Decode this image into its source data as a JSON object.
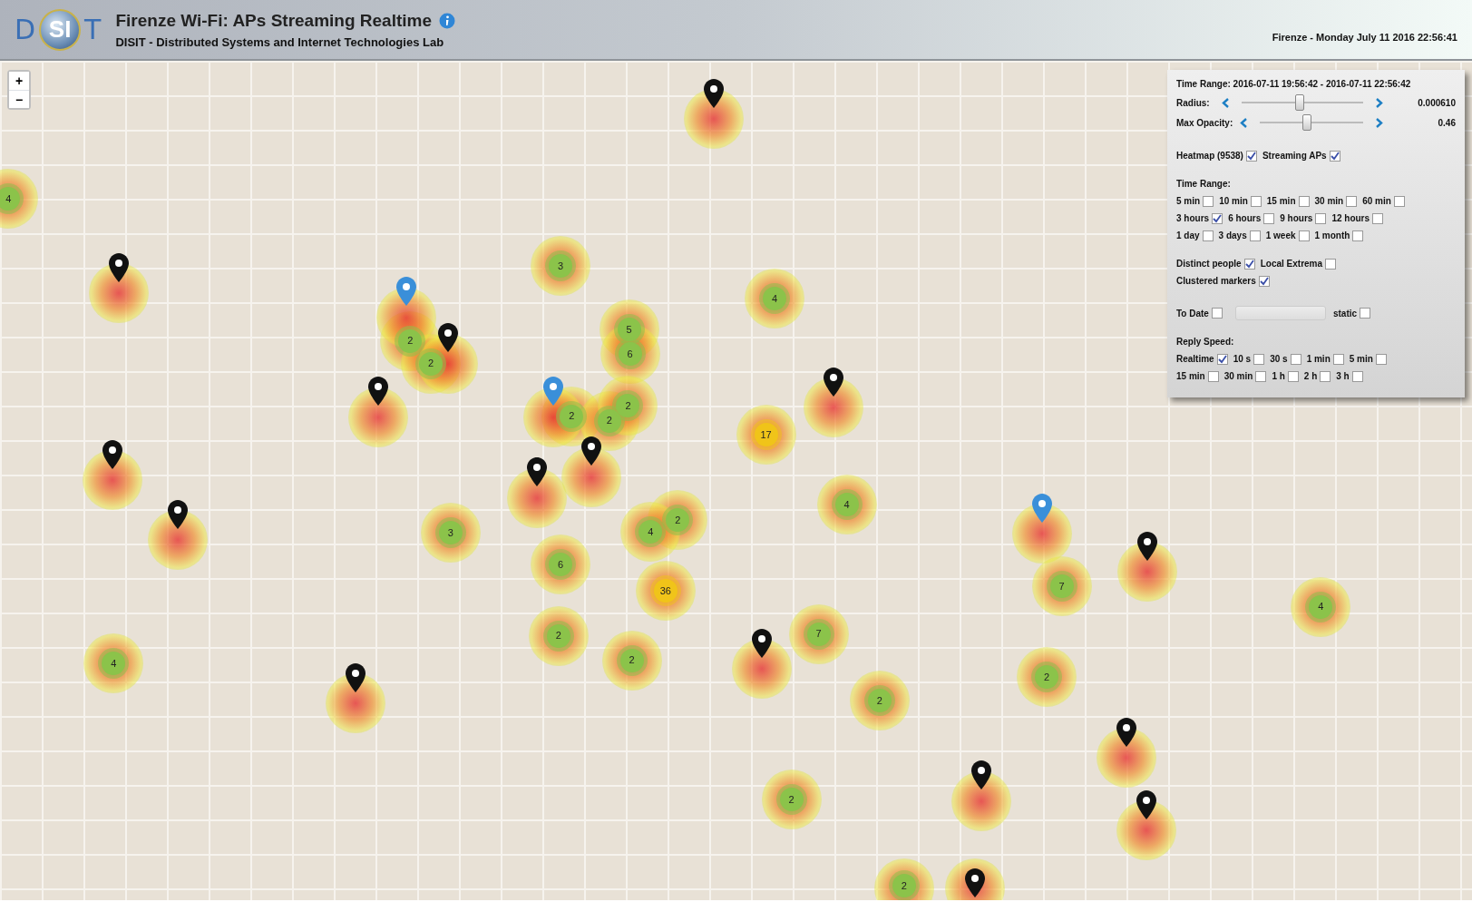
{
  "header": {
    "logo_letters": [
      "D",
      "SI",
      "T"
    ],
    "title": "Firenze Wi-Fi: APs Streaming Realtime",
    "subtitle": "DISIT - Distributed Systems and Internet Technologies Lab",
    "clock": "Firenze - Monday July 11 2016 22:56:41"
  },
  "map": {
    "zoom_in": "+",
    "zoom_out": "−",
    "clusters": [
      {
        "count": "4",
        "color": "#8bc34a"
      },
      {
        "count": "3",
        "color": "#8bc34a"
      },
      {
        "count": "2",
        "color": "#8bc34a"
      },
      {
        "count": "2",
        "color": "#8bc34a"
      },
      {
        "count": "5",
        "color": "#8bc34a"
      },
      {
        "count": "6",
        "color": "#8bc34a"
      },
      {
        "count": "2",
        "color": "#8bc34a"
      },
      {
        "count": "2",
        "color": "#8bc34a"
      },
      {
        "count": "2",
        "color": "#8bc34a"
      },
      {
        "count": "4",
        "color": "#8bc34a"
      },
      {
        "count": "17",
        "color": "#f0c419"
      },
      {
        "count": "4",
        "color": "#8bc34a"
      },
      {
        "count": "2",
        "color": "#8bc34a"
      },
      {
        "count": "4",
        "color": "#8bc34a"
      },
      {
        "count": "3",
        "color": "#8bc34a"
      },
      {
        "count": "6",
        "color": "#8bc34a"
      },
      {
        "count": "36",
        "color": "#f0c419"
      },
      {
        "count": "2",
        "color": "#8bc34a"
      },
      {
        "count": "2",
        "color": "#8bc34a"
      },
      {
        "count": "7",
        "color": "#8bc34a"
      },
      {
        "count": "2",
        "color": "#8bc34a"
      },
      {
        "count": "7",
        "color": "#8bc34a"
      },
      {
        "count": "2",
        "color": "#8bc34a"
      },
      {
        "count": "4",
        "color": "#8bc34a"
      },
      {
        "count": "4",
        "color": "#8bc34a"
      },
      {
        "count": "2",
        "color": "#8bc34a"
      },
      {
        "count": "2",
        "color": "#8bc34a"
      }
    ],
    "pins": [
      {
        "color": "#111111"
      },
      {
        "color": "#111111"
      },
      {
        "color": "#111111"
      },
      {
        "color": "#111111"
      },
      {
        "color": "#111111"
      },
      {
        "color": "#111111"
      },
      {
        "color": "#111111"
      },
      {
        "color": "#111111"
      },
      {
        "color": "#111111"
      },
      {
        "color": "#111111"
      },
      {
        "color": "#111111"
      },
      {
        "color": "#111111"
      },
      {
        "color": "#111111"
      },
      {
        "color": "#111111"
      },
      {
        "color": "#111111"
      },
      {
        "color": "#111111"
      },
      {
        "color": "#3a8fd9"
      },
      {
        "color": "#3a8fd9"
      },
      {
        "color": "#3a8fd9"
      }
    ]
  },
  "panel": {
    "time_range_text": "Time Range: 2016-07-11 19:56:42 - 2016-07-11 22:56:42",
    "sliders": [
      {
        "label": "Radius:",
        "value": "0.000610",
        "level": 0.48
      },
      {
        "label": "Max Opacity:",
        "value": "0.46",
        "level": 0.46
      }
    ],
    "layers": [
      {
        "label": "Heatmap (9538)",
        "checked": true
      },
      {
        "label": "Streaming APs",
        "checked": true
      }
    ],
    "time_range_heading": "Time Range:",
    "time_ranges": [
      [
        {
          "label": "5 min",
          "checked": false
        },
        {
          "label": "10 min",
          "checked": false
        },
        {
          "label": "15 min",
          "checked": false
        },
        {
          "label": "30 min",
          "checked": false
        },
        {
          "label": "60 min",
          "checked": false
        }
      ],
      [
        {
          "label": "3 hours",
          "checked": true
        },
        {
          "label": "6 hours",
          "checked": false
        },
        {
          "label": "9 hours",
          "checked": false
        },
        {
          "label": "12 hours",
          "checked": false
        }
      ],
      [
        {
          "label": "1 day",
          "checked": false
        },
        {
          "label": "3 days",
          "checked": false
        },
        {
          "label": "1 week",
          "checked": false
        },
        {
          "label": "1 month",
          "checked": false
        }
      ]
    ],
    "options": [
      [
        {
          "label": "Distinct people",
          "checked": true
        },
        {
          "label": "Local Extrema",
          "checked": false
        }
      ],
      [
        {
          "label": "Clustered markers",
          "checked": true
        }
      ]
    ],
    "to_date": {
      "label": "To Date",
      "checked": false
    },
    "static": {
      "label": "static",
      "checked": false
    },
    "reply_heading": "Reply Speed:",
    "reply_speeds": [
      [
        {
          "label": "Realtime",
          "checked": true
        },
        {
          "label": "10 s",
          "checked": false
        },
        {
          "label": "30 s",
          "checked": false
        },
        {
          "label": "1 min",
          "checked": false
        },
        {
          "label": "5 min",
          "checked": false
        }
      ],
      [
        {
          "label": "15 min",
          "checked": false
        },
        {
          "label": "30 min",
          "checked": false
        },
        {
          "label": "1 h",
          "checked": false
        },
        {
          "label": "2 h",
          "checked": false
        },
        {
          "label": "3 h",
          "checked": false
        }
      ]
    ]
  }
}
